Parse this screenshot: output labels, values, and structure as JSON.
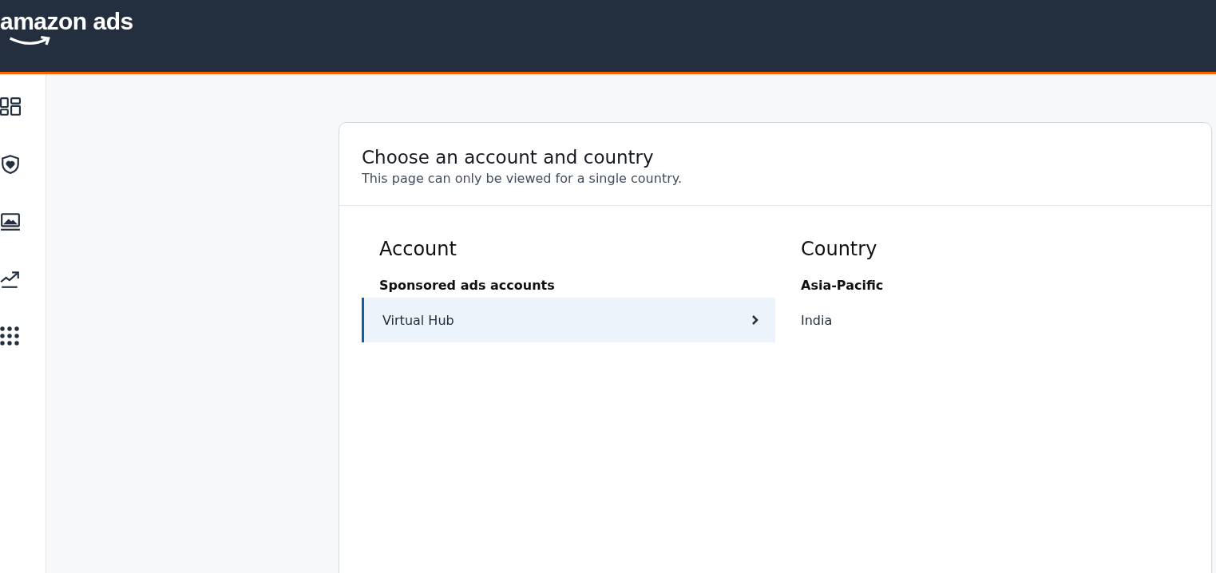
{
  "header": {
    "logo": "amazon ads"
  },
  "card": {
    "title": "Choose an account and country",
    "subtitle": "This page can only be viewed for a single country.",
    "account": {
      "heading": "Account",
      "group": "Sponsored ads accounts",
      "items": [
        {
          "label": "Virtual Hub",
          "selected": true
        }
      ]
    },
    "country": {
      "heading": "Country",
      "group": "Asia-Pacific",
      "items": [
        {
          "label": "India",
          "selected": false
        }
      ]
    }
  }
}
